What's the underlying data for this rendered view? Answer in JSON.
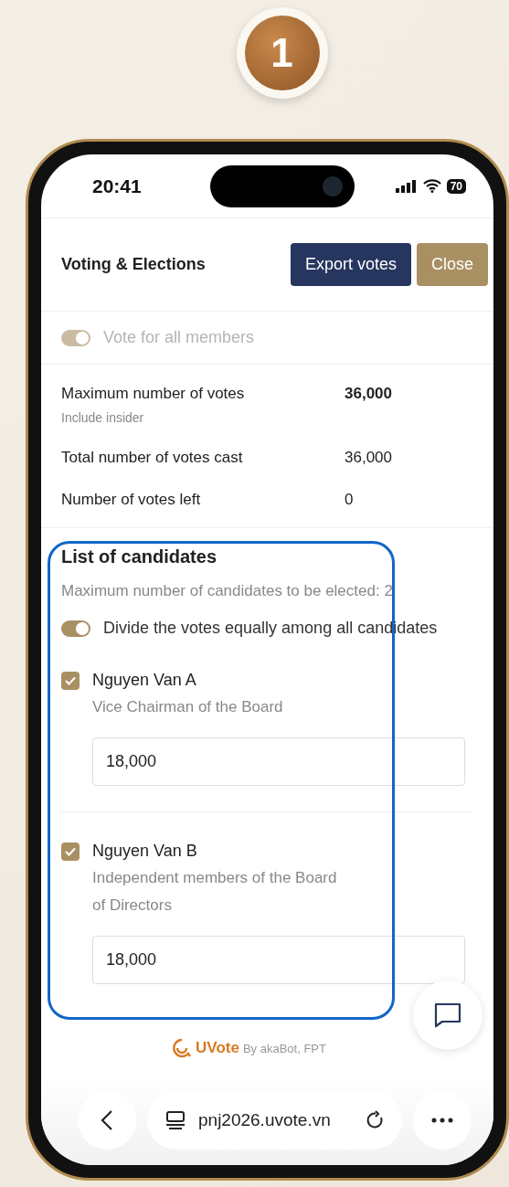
{
  "step_badge": "1",
  "status_bar": {
    "time": "20:41",
    "battery": "70"
  },
  "header": {
    "title": "Voting & Elections",
    "buttons": [
      {
        "label": "Export votes",
        "kind": "primary"
      },
      {
        "label": "Close",
        "kind": "secondary"
      }
    ]
  },
  "vote_all": {
    "label": "Vote for all members",
    "on": true,
    "disabled": true
  },
  "stats": [
    {
      "label": "Maximum number of votes",
      "note": "Include insider",
      "value": "36,000",
      "emphasis": true
    },
    {
      "label": "Total number of votes cast",
      "value": "36,000",
      "emphasis": false
    },
    {
      "label": "Number of votes left",
      "value": "0",
      "emphasis": false
    }
  ],
  "candidates": {
    "title": "List of candidates",
    "limit": "Maximum number of candidates to be elected: 2",
    "divide_equally": {
      "label": "Divide the votes equally among all candidates",
      "on": true
    },
    "items": [
      {
        "name": "Nguyen Van A",
        "position": "Vice Chairman of the Board",
        "checked": true,
        "votes": "18,000"
      },
      {
        "name": "Nguyen Van B",
        "position": "Independent members of the Board of Directors",
        "checked": true,
        "votes": "18,000"
      }
    ]
  },
  "footer": {
    "brand": "UVote",
    "credit": "By akaBot, FPT"
  },
  "browser": {
    "url": "pnj2026.uvote.vn"
  }
}
